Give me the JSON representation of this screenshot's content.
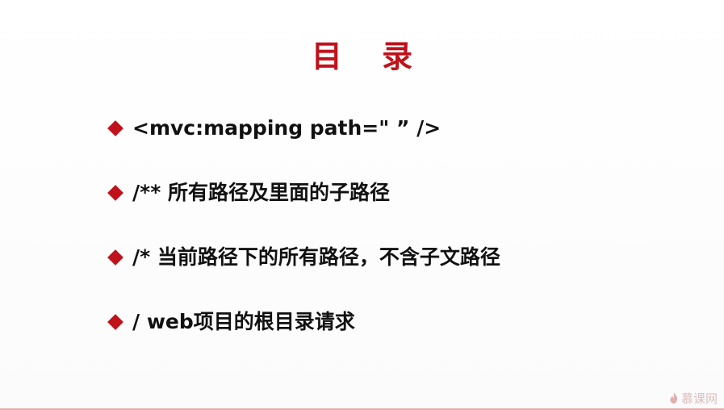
{
  "slide": {
    "title": "目 录",
    "bullets": [
      "<mvc:mapping path=\" ” />",
      "/** 所有路径及里面的子路径",
      "/* 当前路径下的所有路径，不含子文路径",
      "/ web项目的根目录请求"
    ]
  },
  "watermark": {
    "text": "慕课网",
    "icon": "flame-icon"
  },
  "colors": {
    "accent": "#c0121b",
    "text": "#111111"
  }
}
